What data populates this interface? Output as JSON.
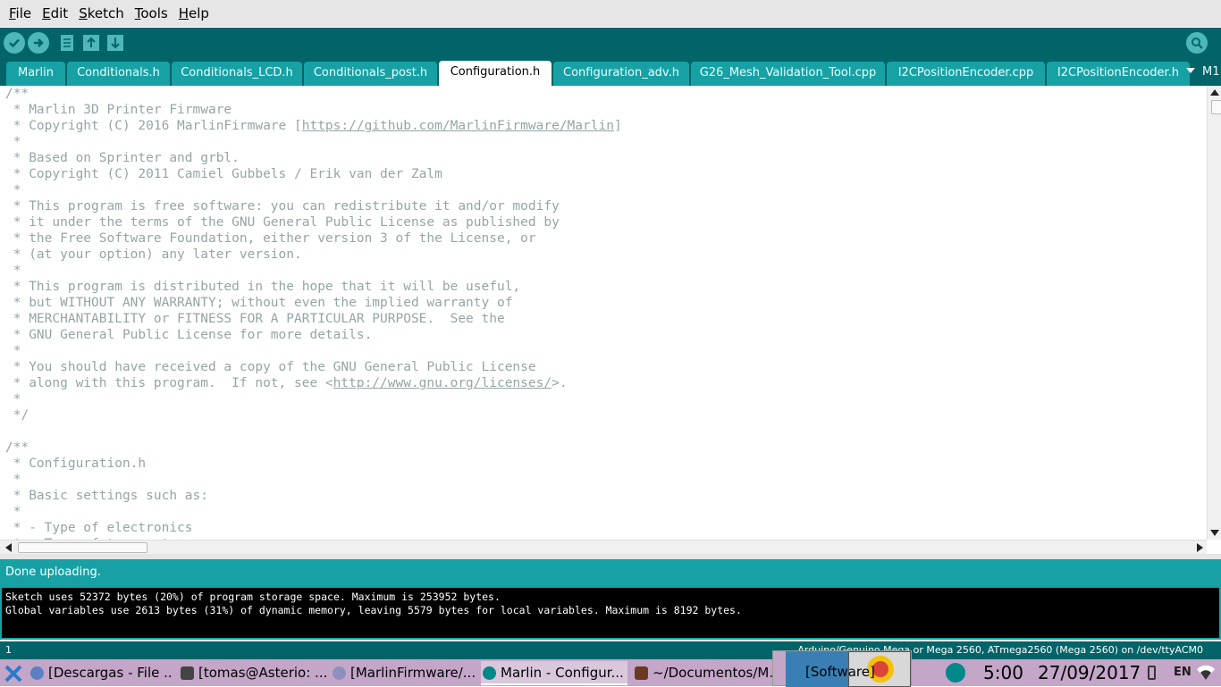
{
  "menubar": {
    "items": [
      {
        "mnemonic": "F",
        "rest": "ile"
      },
      {
        "mnemonic": "E",
        "rest": "dit"
      },
      {
        "mnemonic": "S",
        "rest": "ketch"
      },
      {
        "mnemonic": "T",
        "rest": "ools"
      },
      {
        "mnemonic": "H",
        "rest": "elp"
      }
    ]
  },
  "toolbar": {
    "buttons": [
      "verify-icon",
      "upload-icon",
      "new-icon",
      "open-icon",
      "save-icon"
    ],
    "serial_monitor_icon": "serial-monitor-icon"
  },
  "tabs": {
    "items": [
      {
        "label": "Marlin",
        "active": false
      },
      {
        "label": "Conditionals.h",
        "active": false
      },
      {
        "label": "Conditionals_LCD.h",
        "active": false
      },
      {
        "label": "Conditionals_post.h",
        "active": false
      },
      {
        "label": "Configuration.h",
        "active": true
      },
      {
        "label": "Configuration_adv.h",
        "active": false
      },
      {
        "label": "G26_Mesh_Validation_Tool.cpp",
        "active": false
      },
      {
        "label": "I2CPositionEncoder.cpp",
        "active": false
      },
      {
        "label": "I2CPositionEncoder.h",
        "active": false
      }
    ],
    "overflow_label": "M1"
  },
  "editor": {
    "lines": [
      "/**",
      " * Marlin 3D Printer Firmware",
      " * Copyright (C) 2016 MarlinFirmware [https://github.com/MarlinFirmware/Marlin]",
      " *",
      " * Based on Sprinter and grbl.",
      " * Copyright (C) 2011 Camiel Gubbels / Erik van der Zalm",
      " *",
      " * This program is free software: you can redistribute it and/or modify",
      " * it under the terms of the GNU General Public License as published by",
      " * the Free Software Foundation, either version 3 of the License, or",
      " * (at your option) any later version.",
      " *",
      " * This program is distributed in the hope that it will be useful,",
      " * but WITHOUT ANY WARRANTY; without even the implied warranty of",
      " * MERCHANTABILITY or FITNESS FOR A PARTICULAR PURPOSE.  See the",
      " * GNU General Public License for more details.",
      " *",
      " * You should have received a copy of the GNU General Public License",
      " * along with this program.  If not, see <http://www.gnu.org/licenses/>.",
      " *",
      " */",
      "",
      "/**",
      " * Configuration.h",
      " *",
      " * Basic settings such as:",
      " *",
      " * - Type of electronics",
      " * - Type of temperature sensor"
    ]
  },
  "status": {
    "message": "Done uploading."
  },
  "console": {
    "lines": [
      "Sketch uses 52372 bytes (20%) of program storage space. Maximum is 253952 bytes.",
      "Global variables use 2613 bytes (31%) of dynamic memory, leaving 5579 bytes for local variables. Maximum is 8192 bytes."
    ]
  },
  "footer": {
    "line_number": "1",
    "board": "Arduino/Genuino Mega or Mega 2560, ATmega2560 (Mega 2560) on /dev/ttyACM0"
  },
  "taskbar": {
    "tasks": [
      {
        "label": "[Descargas - File ...",
        "icon": "download-icon",
        "active": false
      },
      {
        "label": "[tomas@Asterio: ...",
        "icon": "terminal-icon",
        "active": false
      },
      {
        "label": "[MarlinFirmware/...",
        "icon": "chrome-icon",
        "active": false
      },
      {
        "label": "Marlin - Configur...",
        "icon": "arduino-icon",
        "active": true
      },
      {
        "label": "~/Documentos/M...",
        "icon": "image-icon",
        "active": false
      }
    ],
    "preview_label": "[Software]",
    "clock": "5:00",
    "date": "27/09/2017",
    "language": "EN"
  },
  "colors": {
    "toolbar_bg": "#006468",
    "tab_bg": "#17a1a5",
    "status_bg": "#17a1a5",
    "taskbar_bg": "#c4a6c9"
  }
}
